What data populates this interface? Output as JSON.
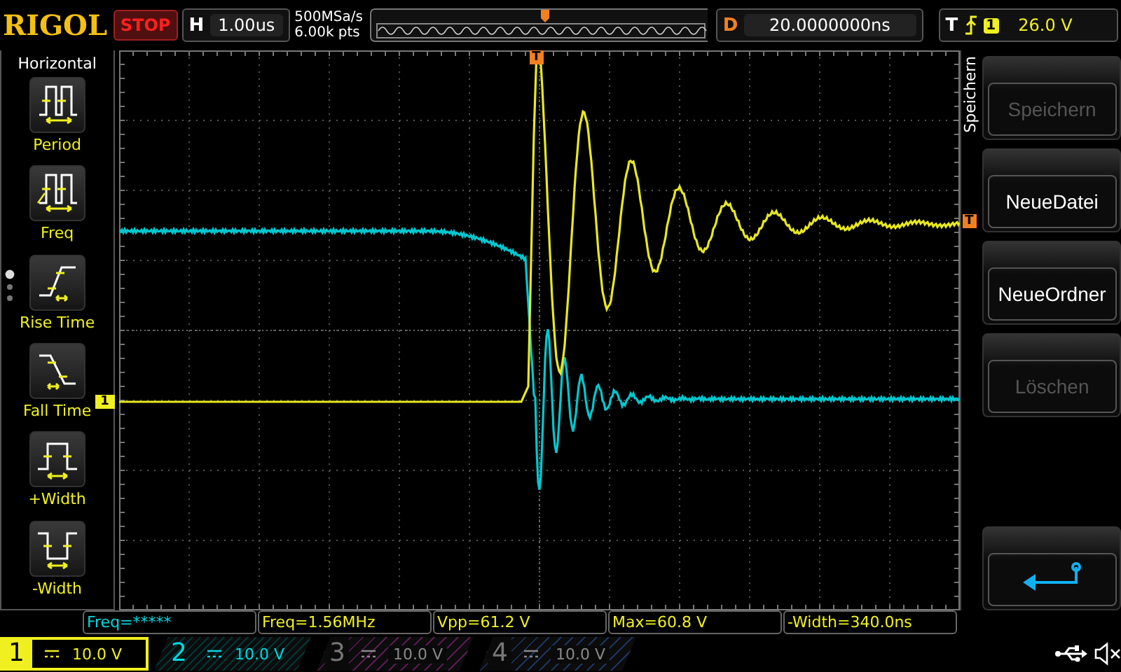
{
  "header": {
    "brand": "RIGOL",
    "run_state": "STOP",
    "timebase_label": "H",
    "timebase": "1.00us",
    "sample_rate": "500MSa/s",
    "memory_depth": "6.00k pts",
    "delay_label": "D",
    "delay": "20.0000000ns",
    "trigger_label": "T",
    "trigger_source": "1",
    "trigger_level": "26.0 V"
  },
  "measure_menu": {
    "title": "Horizontal",
    "items": [
      {
        "label": "Period",
        "kind": "period"
      },
      {
        "label": "Freq",
        "kind": "freq"
      },
      {
        "label": "Rise Time",
        "kind": "rise"
      },
      {
        "label": "Fall Time",
        "kind": "fall"
      },
      {
        "label": "+Width",
        "kind": "pwidth"
      },
      {
        "label": "-Width",
        "kind": "nwidth"
      }
    ]
  },
  "plot": {
    "trigger_marker": "T",
    "trigger_level_marker": "T",
    "channel_marker": "1"
  },
  "save_menu": {
    "title": "Speichern",
    "buttons": [
      {
        "label": "Speichern",
        "disabled": true
      },
      {
        "label": "NeueDatei",
        "disabled": false
      },
      {
        "label": "NeueOrdner",
        "disabled": false
      },
      {
        "label": "Löschen",
        "disabled": true
      }
    ]
  },
  "measurements": [
    {
      "text": "Freq=*****",
      "color": "#00d8e0"
    },
    {
      "text": "Freq=1.56MHz",
      "color": "#f0f020"
    },
    {
      "text": "Vpp=61.2 V",
      "color": "#f0f020"
    },
    {
      "text": "Max=60.8 V",
      "color": "#f0f020"
    },
    {
      "text": "-Width=340.0ns",
      "color": "#f0f020"
    }
  ],
  "channels": [
    {
      "number": "1",
      "scale": "10.0 V",
      "selected": true,
      "on": true,
      "color": "#f0f020"
    },
    {
      "number": "2",
      "scale": "10.0 V",
      "selected": false,
      "on": true,
      "color": "#00d8e0"
    },
    {
      "number": "3",
      "scale": "10.0 V",
      "selected": false,
      "on": false,
      "color": "#5a1a52"
    },
    {
      "number": "4",
      "scale": "10.0 V",
      "selected": false,
      "on": false,
      "color": "#1c3460"
    }
  ]
}
